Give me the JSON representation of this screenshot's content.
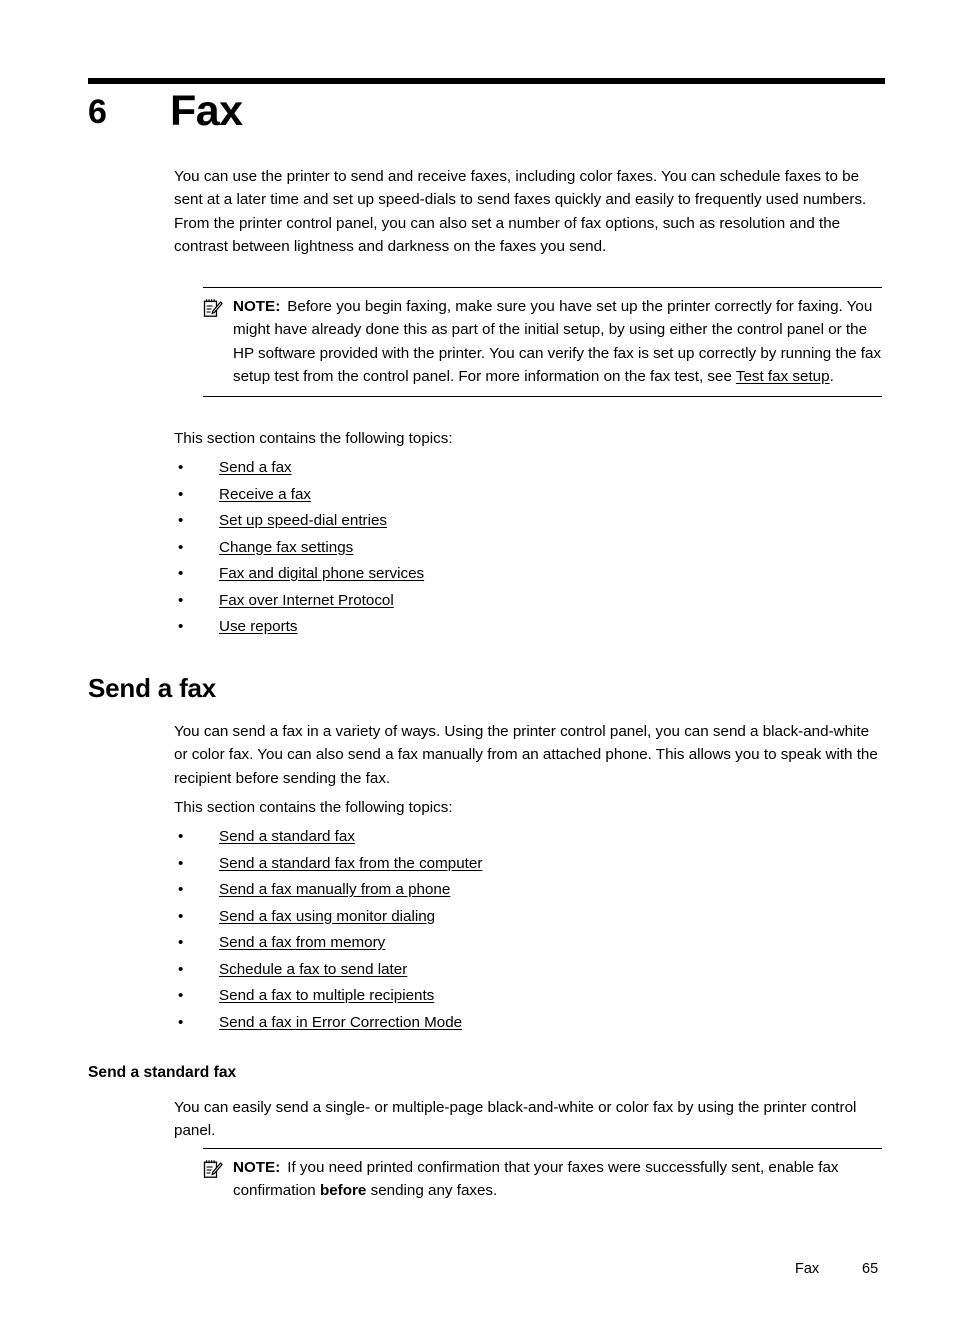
{
  "chapter": {
    "number": "6",
    "title": "Fax"
  },
  "intro_paragraph": "You can use the printer to send and receive faxes, including color faxes. You can schedule faxes to be sent at a later time and set up speed-dials to send faxes quickly and easily to frequently used numbers. From the printer control panel, you can also set a number of fax options, such as resolution and the contrast between lightness and darkness on the faxes you send.",
  "note_1": {
    "icon": "note-pencil-icon",
    "label": "NOTE:",
    "text_before_link": "Before you begin faxing, make sure you have set up the printer correctly for faxing. You might have already done this as part of the initial setup, by using either the control panel or the HP software provided with the printer. You can verify the fax is set up correctly by running the fax setup test from the control panel. For more information on the fax test, see ",
    "link": "Test fax setup",
    "text_after_link": "."
  },
  "topics_lead_1": "This section contains the following topics:",
  "topic_list_1": {
    "bullet": "•",
    "items": [
      {
        "label": "Send a fax"
      },
      {
        "label": "Receive a fax"
      },
      {
        "label": "Set up speed-dial entries"
      },
      {
        "label": "Change fax settings"
      },
      {
        "label": "Fax and digital phone services"
      },
      {
        "label": "Fax over Internet Protocol"
      },
      {
        "label": "Use reports"
      }
    ]
  },
  "section": {
    "heading": "Send a fax",
    "paragraph": "You can send a fax in a variety of ways. Using the printer control panel, you can send a black-and-white or color fax. You can also send a fax manually from an attached phone. This allows you to speak with the recipient before sending the fax.",
    "topics_lead": "This section contains the following topics:"
  },
  "topic_list_2": {
    "bullet": "•",
    "items": [
      {
        "label": "Send a standard fax"
      },
      {
        "label": "Send a standard fax from the computer"
      },
      {
        "label": "Send a fax manually from a phone"
      },
      {
        "label": "Send a fax using monitor dialing"
      },
      {
        "label": "Send a fax from memory"
      },
      {
        "label": "Schedule a fax to send later"
      },
      {
        "label": "Send a fax to multiple recipients"
      },
      {
        "label": "Send a fax in Error Correction Mode"
      }
    ]
  },
  "subsection": {
    "heading": "Send a standard fax",
    "paragraph": "You can easily send a single- or multiple-page black-and-white or color fax by using the printer control panel."
  },
  "note_2": {
    "icon": "note-pencil-icon",
    "label": "NOTE:",
    "text_before_bold": "If you need printed confirmation that your faxes were successfully sent, enable fax confirmation ",
    "bold_word": "before",
    "text_after_bold": " sending any faxes."
  },
  "footer": {
    "section_name": "Fax",
    "page_number": "65"
  },
  "colors": {
    "text": "#000000",
    "rule": "#000000",
    "background": "#ffffff"
  }
}
